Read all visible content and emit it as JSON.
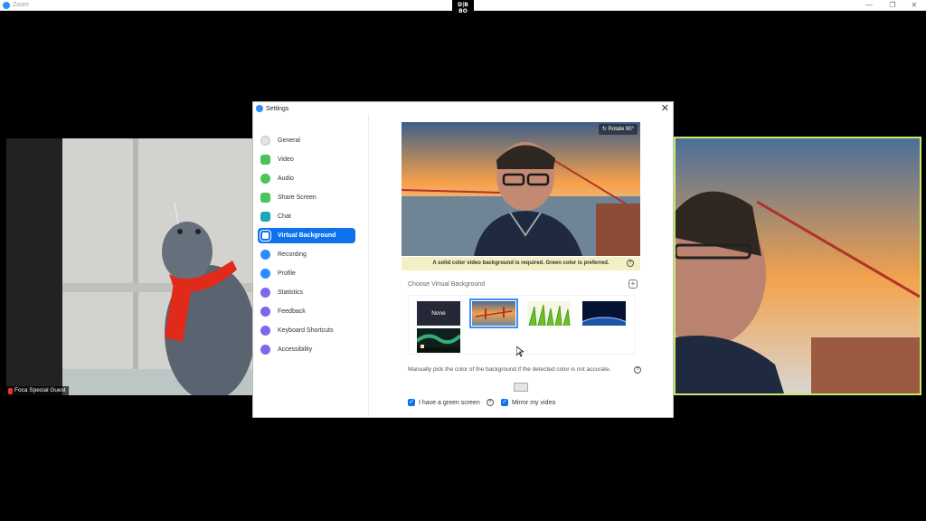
{
  "window": {
    "title": "Zoom",
    "logo_text_top": "D|B",
    "logo_text_bottom": "BO",
    "minimize": "—",
    "maximize": "❐",
    "close": "✕"
  },
  "participants": {
    "left": {
      "name": "Foca Special Guest",
      "muted": true
    },
    "right": {
      "name": "",
      "active_speaker": true,
      "highlight_color": "#c8e86b"
    }
  },
  "settings": {
    "title": "Settings",
    "close": "✕",
    "nav": [
      {
        "label": "General",
        "icon": "gear-icon",
        "color": "#c8c8c8"
      },
      {
        "label": "Video",
        "icon": "video-icon",
        "color": "#4cc35a"
      },
      {
        "label": "Audio",
        "icon": "headphones-icon",
        "color": "#4cc35a"
      },
      {
        "label": "Share Screen",
        "icon": "share-screen-icon",
        "color": "#4cc35a"
      },
      {
        "label": "Chat",
        "icon": "chat-icon",
        "color": "#1aa7b8"
      },
      {
        "label": "Virtual Background",
        "icon": "portrait-icon",
        "color": "#ffffff",
        "active": true
      },
      {
        "label": "Recording",
        "icon": "record-icon",
        "color": "#2d8cff"
      },
      {
        "label": "Profile",
        "icon": "profile-icon",
        "color": "#2d8cff"
      },
      {
        "label": "Statistics",
        "icon": "statistics-icon",
        "color": "#7b68ee"
      },
      {
        "label": "Feedback",
        "icon": "feedback-icon",
        "color": "#7b68ee"
      },
      {
        "label": "Keyboard Shortcuts",
        "icon": "keyboard-icon",
        "color": "#7b68ee"
      },
      {
        "label": "Accessibility",
        "icon": "accessibility-icon",
        "color": "#7b68ee"
      }
    ],
    "rotate_label": "Rotate 90°",
    "warning": "A solid color video background is required. Green color is preferred.",
    "choose_label": "Choose Virtual Background",
    "backgrounds": [
      {
        "label": "None",
        "selected": false
      },
      {
        "label": "",
        "scene": "golden-gate-bridge",
        "selected": true
      },
      {
        "label": "",
        "scene": "grass",
        "selected": false
      },
      {
        "label": "",
        "scene": "earth-from-space",
        "selected": false
      },
      {
        "label": "",
        "scene": "aurora",
        "selected": false
      }
    ],
    "pick_color_label": "Manually pick the color of the background if the detected color is not accurate.",
    "green_screen": {
      "label": "I have a green screen",
      "checked": true
    },
    "mirror": {
      "label": "Mirror my video",
      "checked": true
    },
    "help": "?",
    "add": "+"
  }
}
